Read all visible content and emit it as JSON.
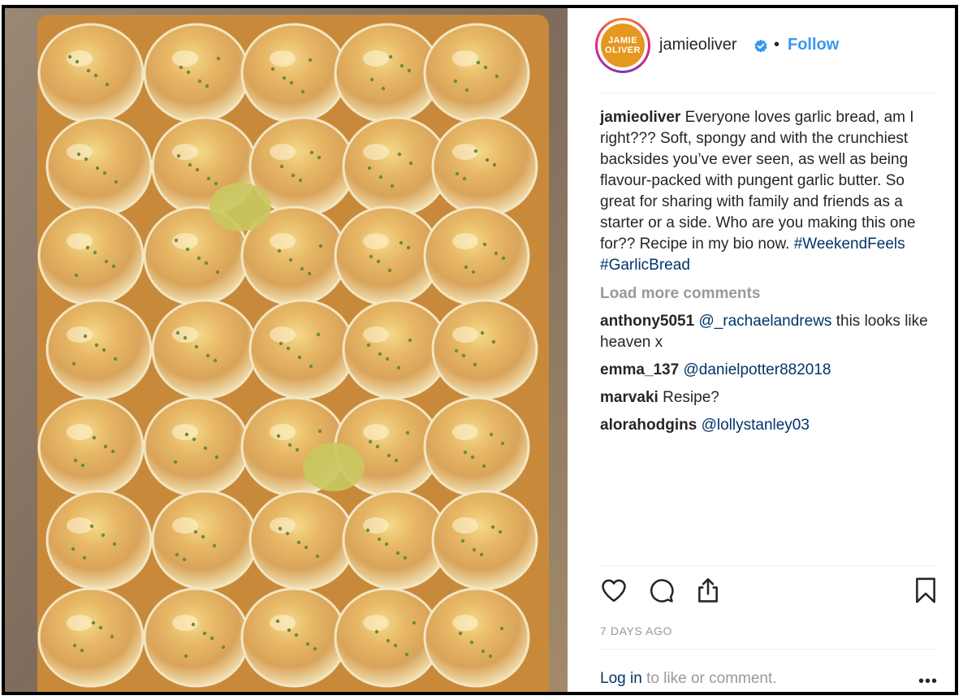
{
  "post": {
    "username": "jamieoliver",
    "avatar_line1": "JAMIE",
    "avatar_line2": "OLIVER",
    "dot": "•",
    "follow_label": "Follow"
  },
  "caption": {
    "username": "jamieoliver",
    "text": "Everyone loves garlic bread, am I right??? Soft, spongy and with the crunchiest backsides you’ve ever seen, as well as being flavour-packed with pungent garlic butter. So great for sharing with family and friends as a starter or a side. Who are you making this one for?? Recipe in my bio now.",
    "hashtag1": "#WeekendFeels",
    "hashtag2": "#GarlicBread"
  },
  "load_more_label": "Load more comments",
  "comments": [
    {
      "username": "anthony5051",
      "mention": "@_rachaelandrews",
      "text": "this looks like heaven x"
    },
    {
      "username": "emma_137",
      "mention": "@danielpotter882018",
      "text": ""
    },
    {
      "username": "marvaki",
      "mention": "",
      "text": "Resipe?"
    },
    {
      "username": "alorahodgins",
      "mention": "@lollystanley03",
      "text": ""
    }
  ],
  "icons": [
    "heart-icon",
    "comment-icon",
    "share-icon",
    "bookmark-icon",
    "verified-icon",
    "more-icon"
  ],
  "timestamp": "7 DAYS AGO",
  "footer": {
    "login_link": "Log in",
    "login_text": "to like or comment.",
    "more_label": "•••"
  },
  "colors": {
    "link": "#003569",
    "follow": "#3897f0",
    "muted": "#999999",
    "verified": "#3897f0"
  }
}
